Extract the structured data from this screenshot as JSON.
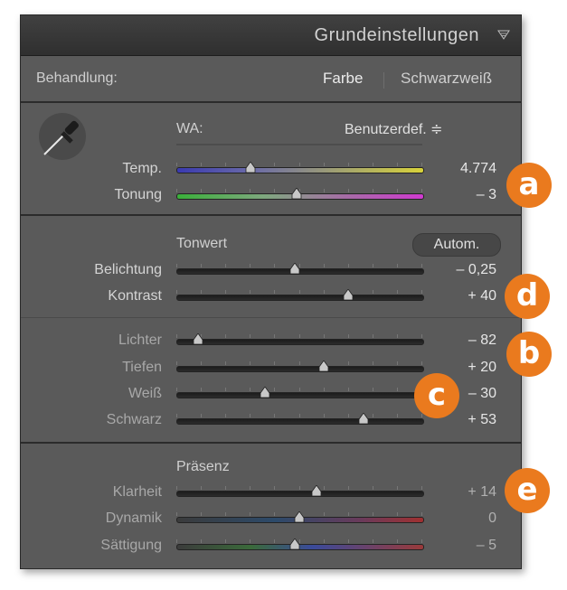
{
  "panel": {
    "title": "Grundeinstellungen"
  },
  "treatment": {
    "label": "Behandlung:",
    "color_option": "Farbe",
    "bw_option": "Schwarzweiß"
  },
  "wb": {
    "label": "WA:",
    "preset": "Benutzerdef. ≑",
    "temp": {
      "label": "Temp.",
      "value": "4.774",
      "pos": 0.3
    },
    "tint": {
      "label": "Tonung",
      "value": "– 3",
      "pos": 0.49
    }
  },
  "tone": {
    "heading": "Tonwert",
    "auto_label": "Autom.",
    "exposure": {
      "label": "Belichtung",
      "value": "– 0,25",
      "pos": 0.48
    },
    "contrast": {
      "label": "Kontrast",
      "value": "+ 40",
      "pos": 0.7
    },
    "highlights": {
      "label": "Lichter",
      "value": "– 82",
      "pos": 0.09
    },
    "shadows": {
      "label": "Tiefen",
      "value": "+ 20",
      "pos": 0.6
    },
    "whites": {
      "label": "Weiß",
      "value": "– 30",
      "pos": 0.36
    },
    "blacks": {
      "label": "Schwarz",
      "value": "+ 53",
      "pos": 0.76
    }
  },
  "presence": {
    "heading": "Präsenz",
    "clarity": {
      "label": "Klarheit",
      "value": "+ 14",
      "pos": 0.57
    },
    "vibrance": {
      "label": "Dynamik",
      "value": "0",
      "pos": 0.5
    },
    "saturation": {
      "label": "Sättigung",
      "value": "– 5",
      "pos": 0.48
    }
  },
  "badges": {
    "a": "a",
    "b": "b",
    "c": "c",
    "d": "d",
    "e": "e"
  },
  "colors": {
    "badge": "#ea7a1e",
    "panel": "#5a5a5a",
    "header": "#383838"
  }
}
